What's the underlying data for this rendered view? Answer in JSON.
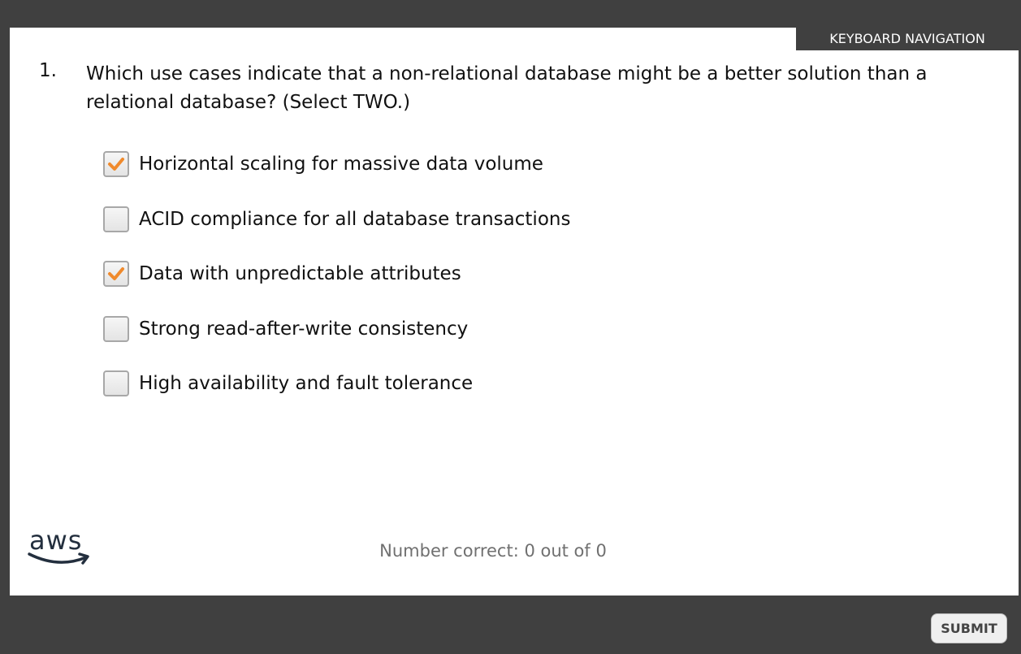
{
  "keyboard_nav_label": "KEYBOARD NAVIGATION",
  "question": {
    "number": "1.",
    "text": "Which use cases indicate that a non-relational database might be a better solution than a relational database? (Select TWO.)"
  },
  "options": [
    {
      "label": "Horizontal scaling for massive data volume",
      "checked": true
    },
    {
      "label": "ACID compliance for all database transactions",
      "checked": false
    },
    {
      "label": "Data with unpredictable attributes",
      "checked": true
    },
    {
      "label": "Strong read-after-write consistency",
      "checked": false
    },
    {
      "label": "High availability and fault tolerance",
      "checked": false
    }
  ],
  "logo_text": "aws",
  "score_text": "Number correct: 0 out of 0",
  "submit_label": "SUBMIT",
  "colors": {
    "frame": "#404040",
    "check": "#f08a2c",
    "score_text": "#707070"
  }
}
